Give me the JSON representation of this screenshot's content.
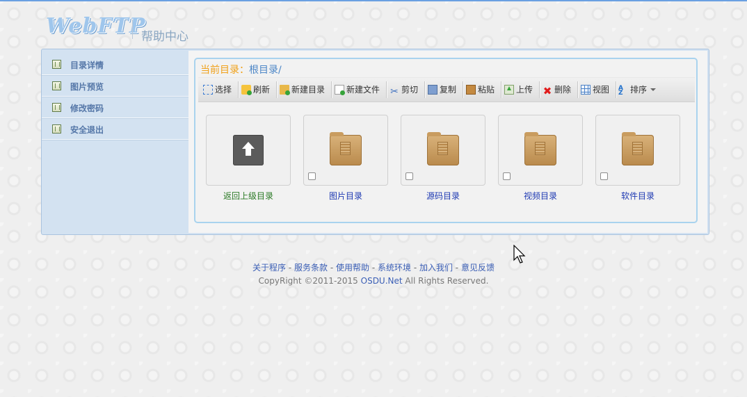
{
  "header": {
    "logo_text": "WebFTP",
    "section_title": "帮助中心"
  },
  "sidebar": {
    "items": [
      {
        "label": "目录详情",
        "icon": "book-icon"
      },
      {
        "label": "图片预览",
        "icon": "book-icon"
      },
      {
        "label": "修改密码",
        "icon": "book-icon"
      },
      {
        "label": "安全退出",
        "icon": "book-icon"
      }
    ]
  },
  "current_dir": {
    "label": "当前目录：",
    "path": "根目录/"
  },
  "toolbar": {
    "select": "选择",
    "refresh": "刷新",
    "new_folder": "新建目录",
    "new_file": "新建文件",
    "cut": "剪切",
    "copy": "复制",
    "paste": "粘贴",
    "upload": "上传",
    "delete": "删除",
    "view": "视图",
    "sort": "排序"
  },
  "tiles": [
    {
      "name": "返回上级目录",
      "type": "parent"
    },
    {
      "name": "图片目录",
      "type": "folder"
    },
    {
      "name": "源码目录",
      "type": "folder"
    },
    {
      "name": "视频目录",
      "type": "folder"
    },
    {
      "name": "软件目录",
      "type": "folder"
    }
  ],
  "footer": {
    "links": [
      "关于程序",
      "服务条款",
      "使用帮助",
      "系统环境",
      "加入我们",
      "意见反馈"
    ],
    "separator": " - ",
    "copyright_prefix": "CopyRight ©2011-2015 ",
    "copyright_link": "OSDU.Net",
    "copyright_suffix": " All Rights Reserved."
  },
  "colors": {
    "accent": "#6aa0e2",
    "dir_label": "#f0a11a",
    "dir_path": "#4d87c7",
    "link": "#3a5eb5"
  }
}
